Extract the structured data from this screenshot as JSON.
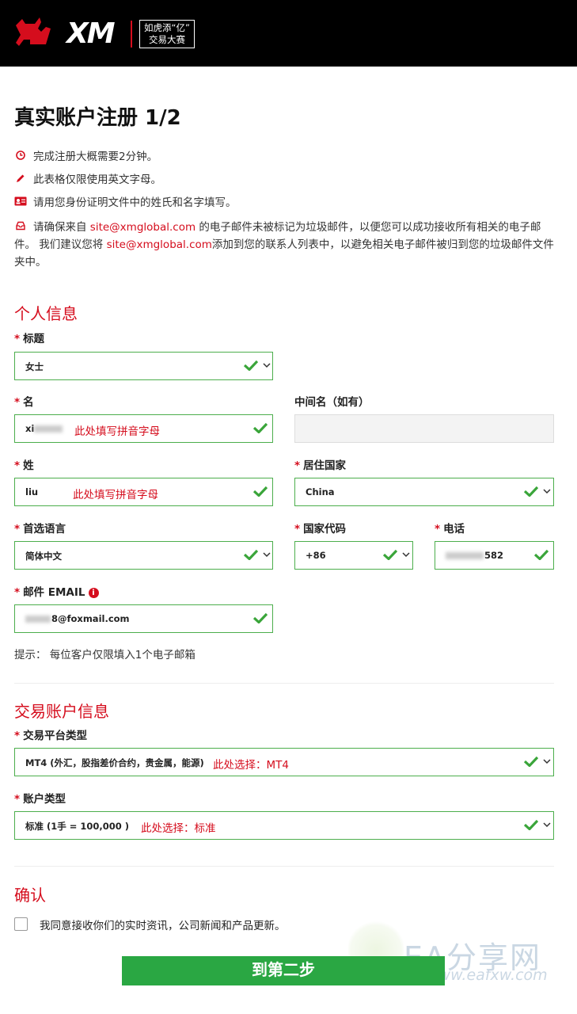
{
  "header": {
    "logo_text": "XM",
    "promo_line1": "如虎添“亿”",
    "promo_line2": "交易大赛"
  },
  "title": "真实账户注册 1/2",
  "notes": [
    {
      "icon": "clock-icon",
      "text": "完成注册大概需要2分钟。"
    },
    {
      "icon": "pencil-icon",
      "text": "此表格仅限使用英文字母。"
    },
    {
      "icon": "id-card-icon",
      "text": "请用您身份证明文件中的姓氏和名字填写。"
    }
  ],
  "email_note": {
    "icon": "inbox-icon",
    "p1": "请确保来自 ",
    "link1": "site@xmglobal.com",
    "p2": " 的电子邮件未被标记为垃圾邮件，以便您可以成功接收所有相关的电子邮件。 我们建议您将 ",
    "link2": "site@xmglobal.com",
    "p3": "添加到您的联系人列表中，以避免相关电子邮件被归到您的垃圾邮件文件夹中。"
  },
  "personal": {
    "section_title": "个人信息",
    "title_label": "标题",
    "title_value": "女士",
    "first_name_label": "名",
    "first_name_value_visible": "xi",
    "first_name_hint": "此处填写拼音字母",
    "middle_name_label": "中间名（如有）",
    "last_name_label": "姓",
    "last_name_value": "liu",
    "last_name_hint": "此处填写拼音字母",
    "country_label": "居住国家",
    "country_value": "China",
    "language_label": "首选语言",
    "language_value": "简体中文",
    "country_code_label": "国家代码",
    "country_code_value": "+86",
    "phone_label": "电话",
    "phone_value_visible": "582",
    "email_label": "邮件 EMAIL",
    "email_value_visible": "8@foxmail.com",
    "email_hint": "提示： 每位客户仅限填入1个电子邮箱"
  },
  "trading": {
    "section_title": "交易账户信息",
    "platform_label": "交易平台类型",
    "platform_value": "MT4 (外汇，股指差价合约，贵金属，能源)",
    "platform_hint": "此处选择：MT4",
    "account_type_label": "账户类型",
    "account_type_value": "标准 (1手 = 100,000 )",
    "account_type_hint": "此处选择：标准"
  },
  "confirm": {
    "section_title": "确认",
    "consent_text": "我同意接收你们的实时资讯，公司新闻和产品更新。",
    "next_button": "到第二步"
  },
  "watermark": {
    "big": "EA分享网",
    "small": "www.eafxw.com"
  },
  "colors": {
    "brand_red": "#d50d1d",
    "valid_green": "#4cae4c",
    "button_green": "#2aa743",
    "header_black": "#000000"
  }
}
